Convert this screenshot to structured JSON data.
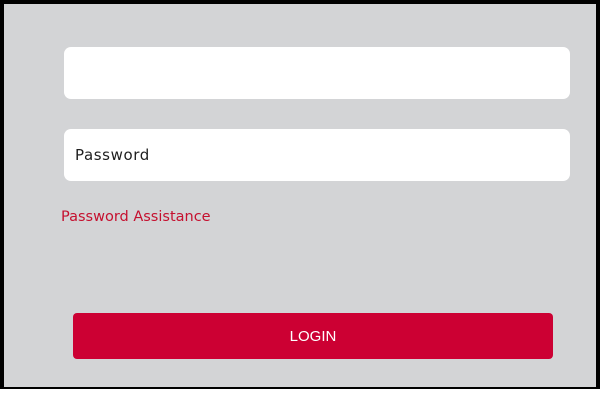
{
  "login_form": {
    "username_value": "",
    "password_placeholder": "Password",
    "password_assistance_label": "Password Assistance",
    "login_label": "LOGIN"
  },
  "colors": {
    "panel_background": "#d3d4d6",
    "accent": "#cc0033",
    "link": "#c5102f"
  }
}
